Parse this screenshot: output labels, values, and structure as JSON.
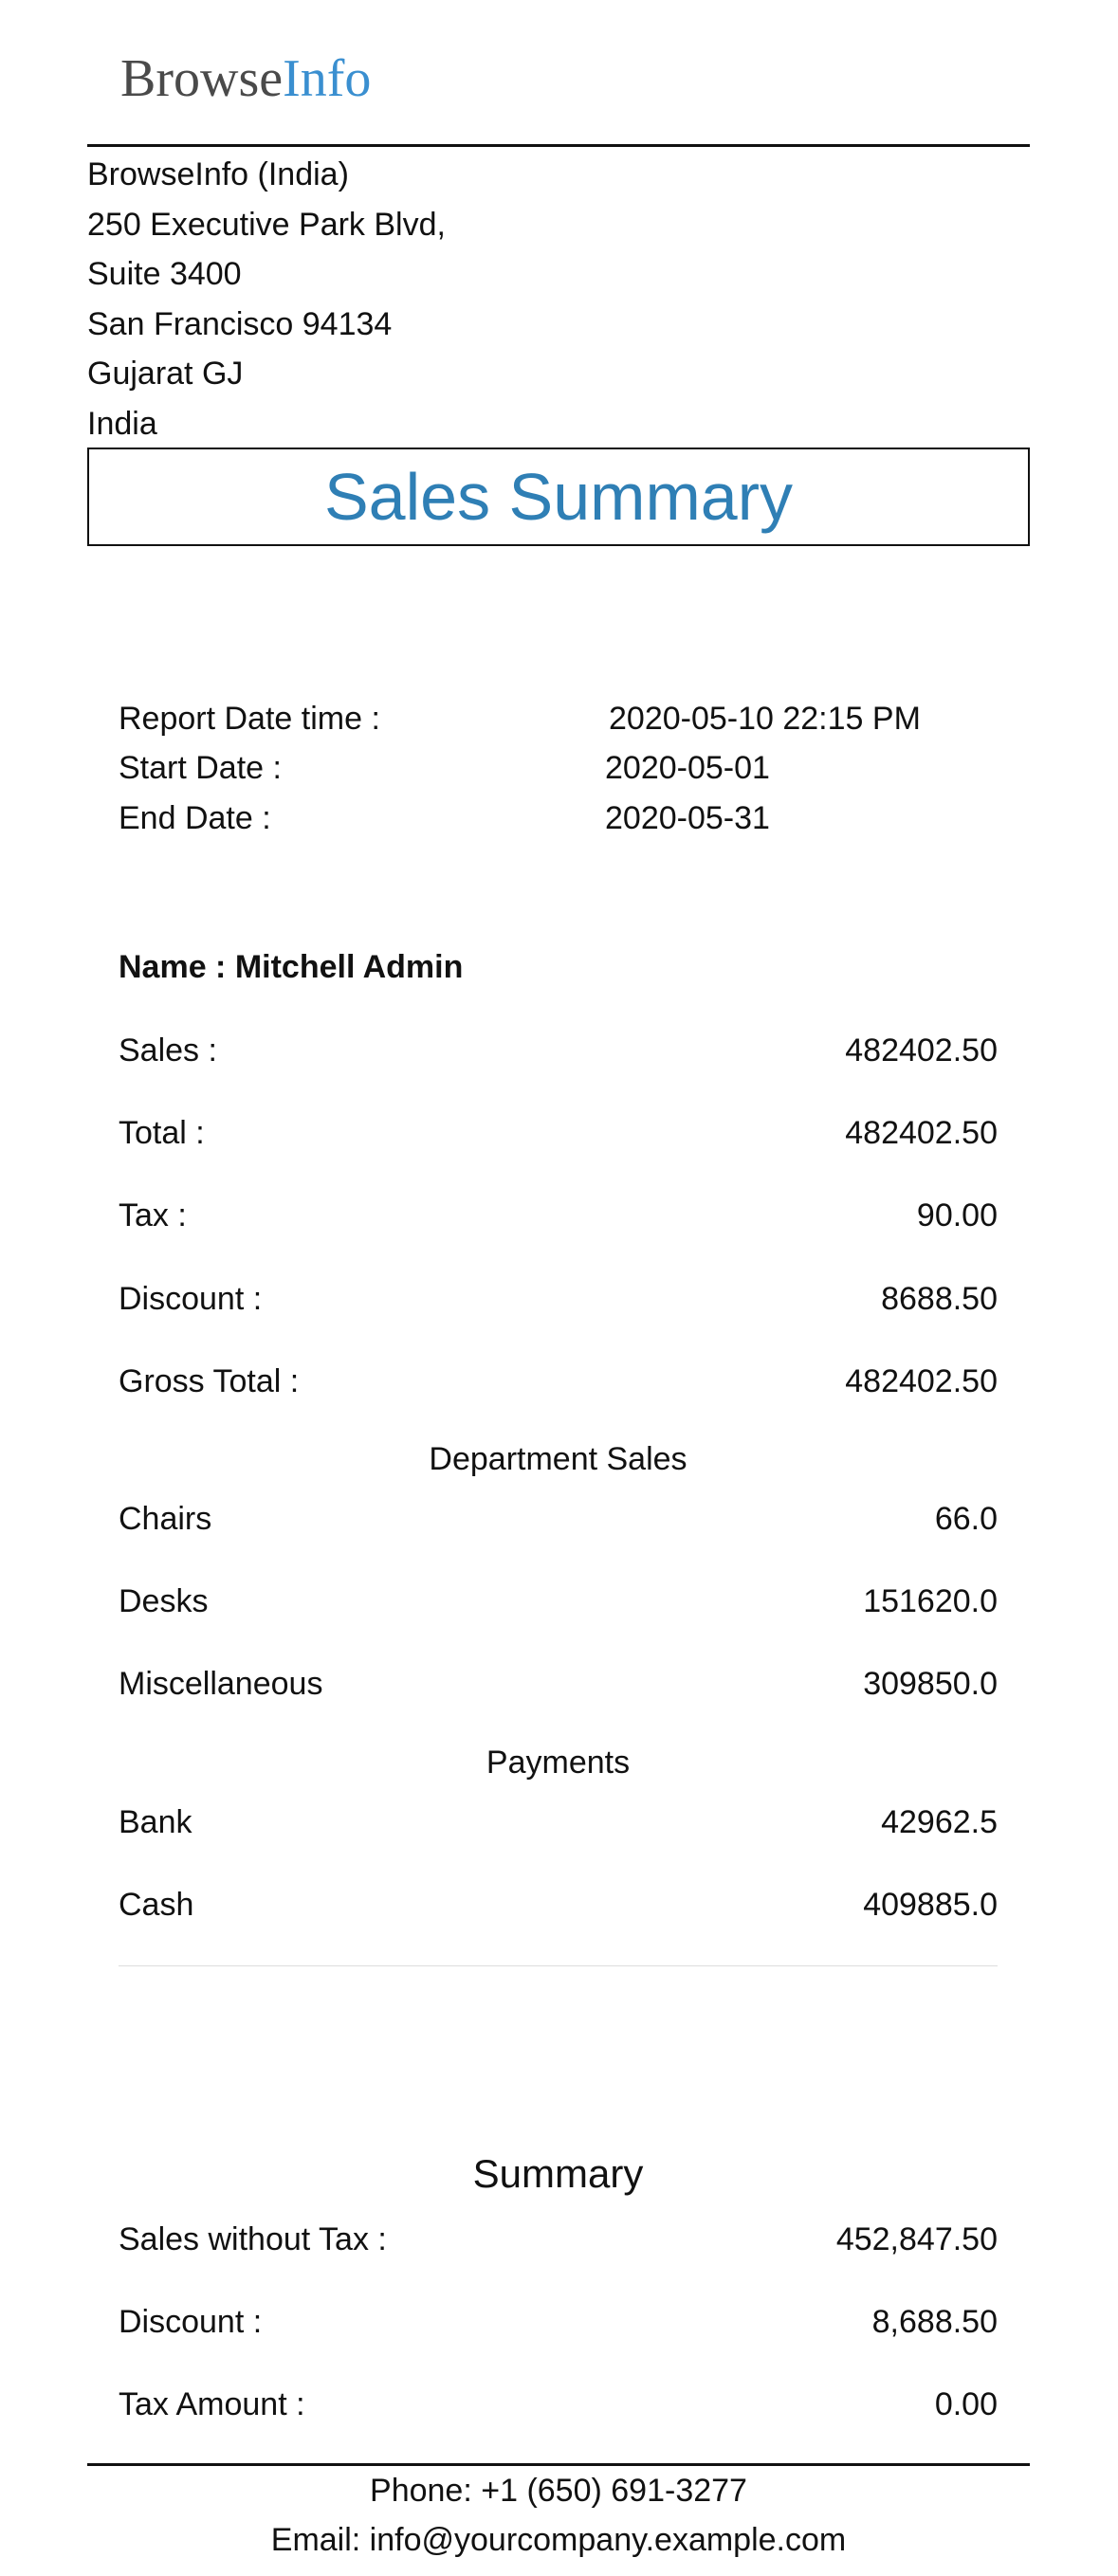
{
  "logo": {
    "part1": "Browse",
    "part2": "Info"
  },
  "address": {
    "lines": [
      "BrowseInfo (India)",
      "250 Executive Park Blvd,",
      "Suite 3400",
      "San Francisco 94134",
      "Gujarat GJ",
      "India"
    ]
  },
  "title": "Sales Summary",
  "report": {
    "datetime_label": "Report Date time :",
    "datetime_value": "2020-05-10 22:15 PM",
    "start_label": "Start Date :",
    "start_value": "2020-05-01",
    "end_label": "End Date :",
    "end_value": "2020-05-31"
  },
  "user": {
    "label": "Name :",
    "value": "Mitchell Admin"
  },
  "totals": [
    {
      "label": "Sales :",
      "value": "482402.50"
    },
    {
      "label": "Total :",
      "value": "482402.50"
    },
    {
      "label": "Tax :",
      "value": "90.00"
    },
    {
      "label": "Discount :",
      "value": "8688.50"
    },
    {
      "label": "Gross Total :",
      "value": "482402.50"
    }
  ],
  "department": {
    "heading": "Department Sales",
    "rows": [
      {
        "label": "Chairs",
        "value": "66.0"
      },
      {
        "label": "Desks",
        "value": "151620.0"
      },
      {
        "label": "Miscellaneous",
        "value": "309850.0"
      }
    ]
  },
  "payments": {
    "heading": "Payments",
    "rows": [
      {
        "label": "Bank",
        "value": "42962.5"
      },
      {
        "label": "Cash",
        "value": "409885.0"
      }
    ]
  },
  "summary": {
    "heading": "Summary",
    "rows": [
      {
        "label": "Sales without Tax :",
        "value": "452,847.50"
      },
      {
        "label": "Discount :",
        "value": "8,688.50"
      },
      {
        "label": "Tax Amount :",
        "value": "0.00"
      }
    ]
  },
  "footer": {
    "phone": "Phone: +1 (650) 691-3277",
    "email": "Email: info@yourcompany.example.com"
  }
}
